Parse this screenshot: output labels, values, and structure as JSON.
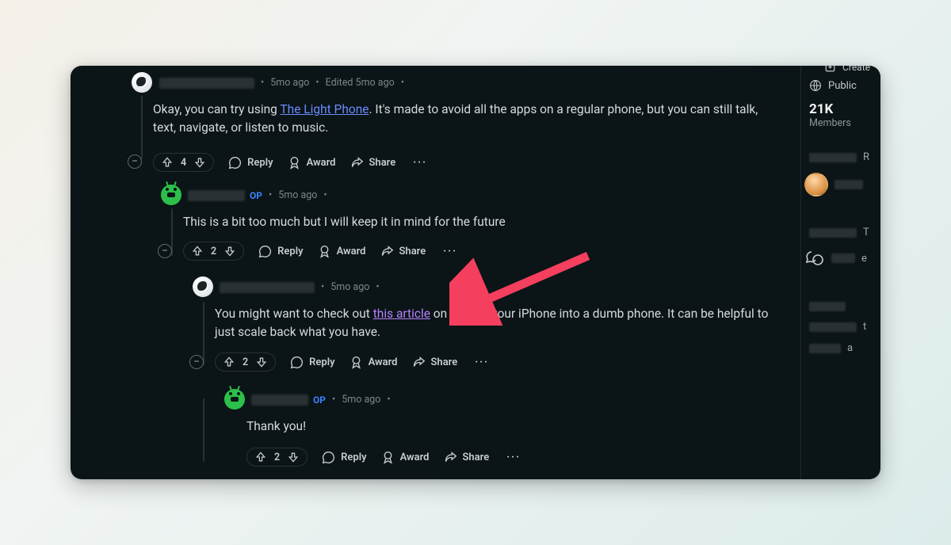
{
  "colors": {
    "link": "#6a8cff",
    "visited": "#b583ff",
    "accent_arrow": "#f43f5e"
  },
  "sidebar": {
    "create_label": "Create",
    "visibility_label": "Public",
    "member_count": "21K",
    "member_label": "Members",
    "rows": [
      {
        "letter": "R"
      },
      {
        "letter": ""
      },
      {
        "letter": "T"
      },
      {
        "letter": "e"
      },
      {
        "letter": ""
      },
      {
        "letter": "t"
      },
      {
        "letter": "a"
      }
    ]
  },
  "actions": {
    "reply": "Reply",
    "award": "Award",
    "share": "Share"
  },
  "thread": [
    {
      "id": "c1",
      "depth": 0,
      "avatar": "white",
      "meta": {
        "age": "5mo ago",
        "edited": "Edited 5mo ago"
      },
      "body_pre": "Okay, you can try using ",
      "body_link": "The Light Phone",
      "body_post": ". It's made to avoid all the apps on a regular phone, but you can still talk, text, navigate, or listen to music.",
      "score": "4"
    },
    {
      "id": "c2",
      "depth": 1,
      "avatar": "green",
      "meta": {
        "op": "OP",
        "age": "5mo ago"
      },
      "body": "This is a bit too much but I will keep it in mind for the future",
      "score": "2"
    },
    {
      "id": "c3",
      "depth": 2,
      "avatar": "white",
      "meta": {
        "age": "5mo ago"
      },
      "body_pre": "You might want to check out ",
      "body_link": "this article",
      "body_post": " on turning your iPhone into a dumb phone. It can be helpful to just scale back what you have.",
      "score": "2"
    },
    {
      "id": "c4",
      "depth": 3,
      "avatar": "green",
      "meta": {
        "op": "OP",
        "age": "5mo ago"
      },
      "body": "Thank you!",
      "score": "2"
    }
  ]
}
